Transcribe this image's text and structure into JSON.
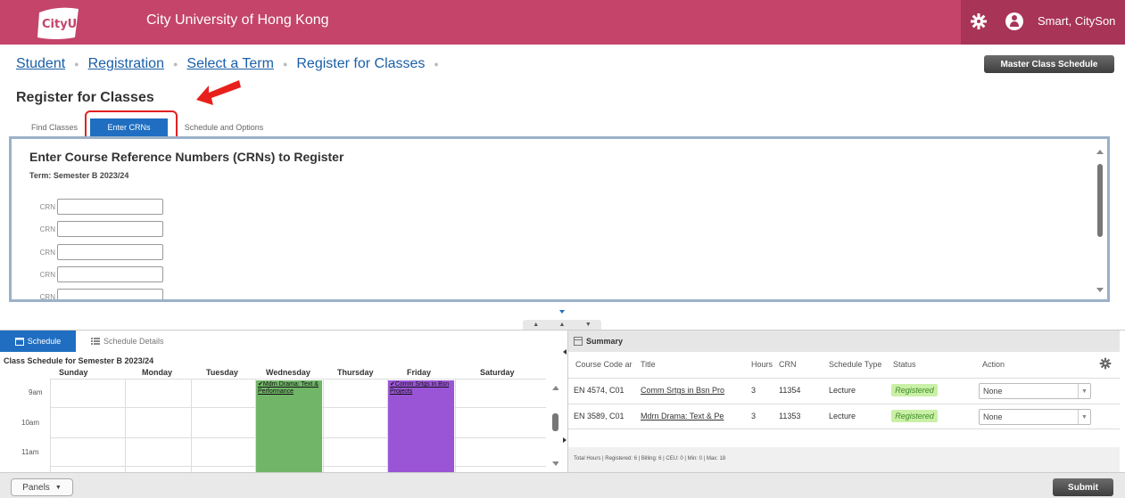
{
  "header": {
    "logo_text": "CityU",
    "university": "City University of Hong Kong",
    "user_name": "Smart, CitySon",
    "brand_color": "#c4446a",
    "icons": [
      "gear-icon",
      "user-icon"
    ]
  },
  "breadcrumb": {
    "items": [
      "Student",
      "Registration",
      "Select a Term"
    ],
    "current": "Register for Classes"
  },
  "master_schedule_button": "Master Class Schedule",
  "page_title": "Register for Classes",
  "tabs": [
    {
      "label": "Find Classes",
      "active": false
    },
    {
      "label": "Enter CRNs",
      "active": true
    },
    {
      "label": "Schedule and Options",
      "active": false
    }
  ],
  "crn_panel": {
    "heading": "Enter Course Reference Numbers (CRNs) to Register",
    "term": "Term: Semester B 2023/24",
    "fields": [
      {
        "label": "CRN",
        "value": ""
      },
      {
        "label": "CRN",
        "value": ""
      },
      {
        "label": "CRN",
        "value": ""
      },
      {
        "label": "CRN",
        "value": ""
      },
      {
        "label": "CRN",
        "value": ""
      }
    ]
  },
  "schedule": {
    "tab_schedule": "Schedule",
    "tab_details": "Schedule Details",
    "title": "Class Schedule for Semester B 2023/24",
    "days": [
      "Sunday",
      "Monday",
      "Tuesday",
      "Wednesday",
      "Thursday",
      "Friday",
      "Saturday"
    ],
    "hours": [
      "9am",
      "10am",
      "11am"
    ],
    "events": [
      {
        "day": "Wednesday",
        "label": "Mdrn Drama: Text & Performance",
        "color": "#71b568"
      },
      {
        "day": "Friday",
        "label": "Comm Srtgs in Bsn Projects",
        "color": "#9a55d6"
      }
    ]
  },
  "summary": {
    "title": "Summary",
    "columns": [
      "Course Code ar",
      "Title",
      "Hours",
      "CRN",
      "Schedule Type",
      "Status",
      "Action"
    ],
    "rows": [
      {
        "code": "EN 4574, C01",
        "title": "Comm Srtgs in Bsn Pro",
        "hours": "3",
        "crn": "11354",
        "type": "Lecture",
        "status": "Registered",
        "action": "None"
      },
      {
        "code": "EN 3589, C01",
        "title": "Mdrn Drama: Text & Pe",
        "hours": "3",
        "crn": "11353",
        "type": "Lecture",
        "status": "Registered",
        "action": "None"
      }
    ],
    "footer": "Total Hours | Registered: 6 | Billing: 6 | CEU: 0 | Min: 0 | Max: 18"
  },
  "bottom": {
    "panels_label": "Panels",
    "submit_label": "Submit"
  }
}
